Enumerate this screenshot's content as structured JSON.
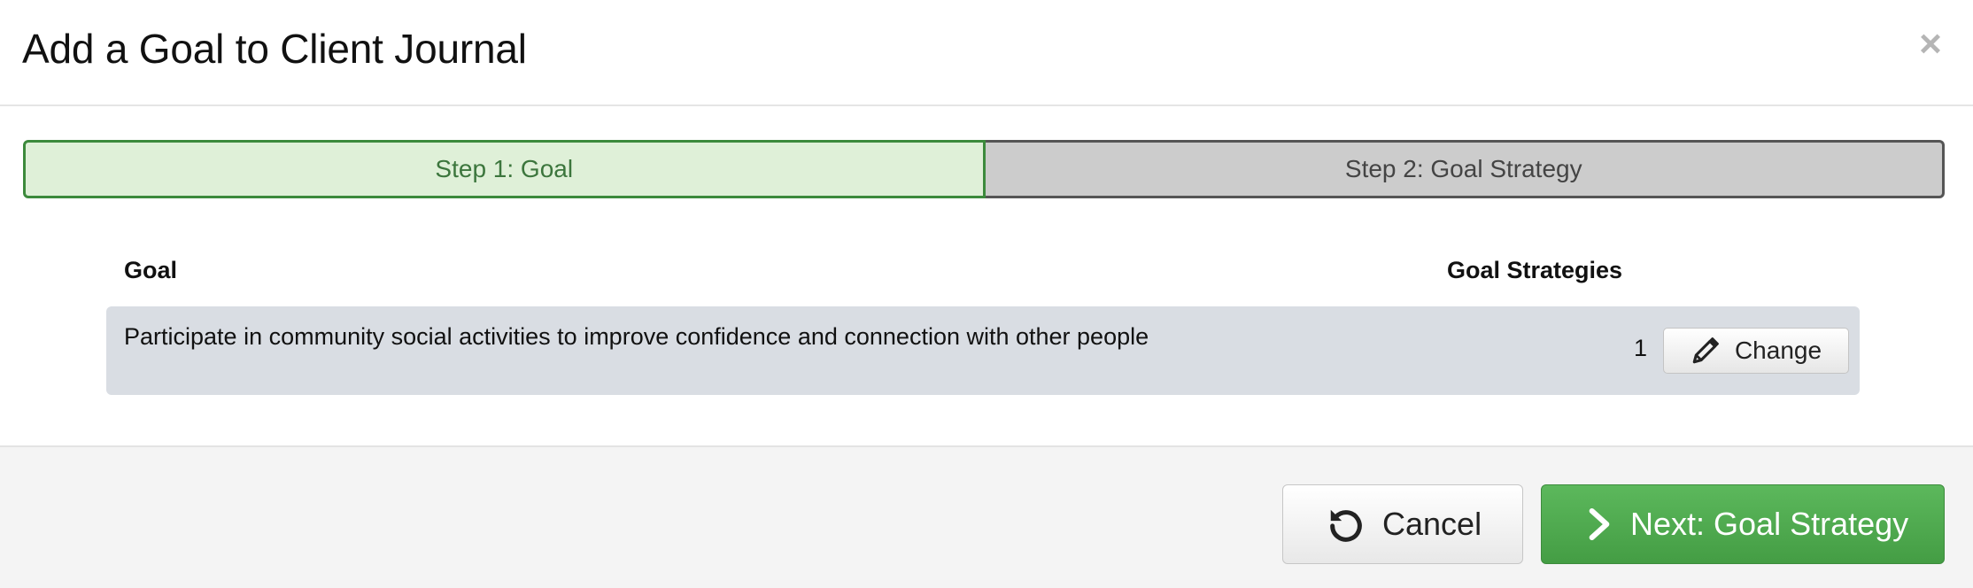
{
  "modal": {
    "title": "Add a Goal to Client Journal",
    "close_label": "×"
  },
  "steps": [
    {
      "label": "Step 1: Goal",
      "active": true
    },
    {
      "label": "Step 2: Goal Strategy",
      "active": false
    }
  ],
  "table": {
    "headers": {
      "goal": "Goal",
      "strategies": "Goal Strategies"
    },
    "rows": [
      {
        "goal": "Participate in community social activities to improve confidence and connection with other people",
        "strategies_count": "1",
        "action_label": "Change",
        "action_icon": "pencil-icon"
      }
    ]
  },
  "footer": {
    "cancel_label": "Cancel",
    "cancel_icon": "undo-icon",
    "next_label": "Next: Goal Strategy",
    "next_icon": "chevron-right-icon"
  },
  "colors": {
    "step_active_bg": "#dff0d8",
    "step_active_border": "#3c8a3c",
    "step_inactive_bg": "#cccccc",
    "row_bg": "#d9dde3",
    "primary_green": "#5cb85c"
  }
}
